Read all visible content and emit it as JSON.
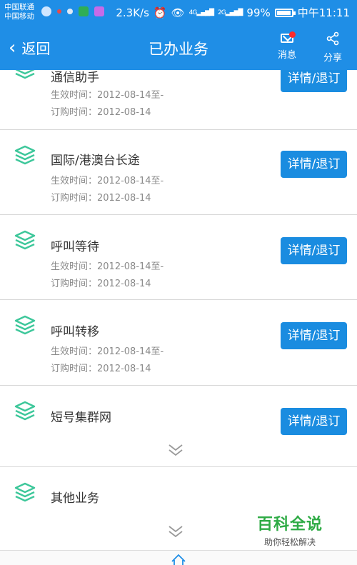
{
  "status_bar": {
    "carrier1": "中国联通",
    "carrier2": "中国移动",
    "speed": "2.3K/s",
    "net1": "4G",
    "net2": "2G",
    "battery": "99%",
    "time": "中午11:11"
  },
  "header": {
    "back_label": "返回",
    "title": "已办业务",
    "messages_label": "消息",
    "share_label": "分享"
  },
  "items": [
    {
      "name": "通信助手",
      "effective": "生效时间：2012-08-14至-",
      "ordered": "订购时间：2012-08-14",
      "action": "详情/退订"
    },
    {
      "name": "国际/港澳台长途",
      "effective": "生效时间：2012-08-14至-",
      "ordered": "订购时间：2012-08-14",
      "action": "详情/退订"
    },
    {
      "name": "呼叫等待",
      "effective": "生效时间：2012-08-14至-",
      "ordered": "订购时间：2012-08-14",
      "action": "详情/退订"
    },
    {
      "name": "呼叫转移",
      "effective": "生效时间：2012-08-14至-",
      "ordered": "订购时间：2012-08-14",
      "action": "详情/退订"
    },
    {
      "name": "短号集群网",
      "action": "详情/退订"
    },
    {
      "name": "其他业务"
    }
  ],
  "watermark": {
    "title": "百科全说",
    "subtitle": "助你轻松解决"
  },
  "colors": {
    "primary": "#1f8ee6",
    "icon_green": "#3dc79a",
    "notify_red": "#ff2a2a"
  }
}
